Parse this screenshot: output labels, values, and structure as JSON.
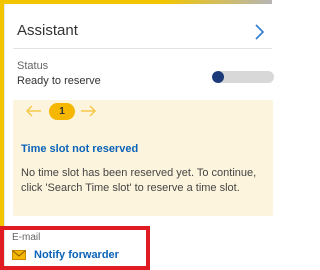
{
  "header": {
    "title": "Assistant"
  },
  "status": {
    "label": "Status",
    "value": "Ready to reserve",
    "toggle_on": false
  },
  "card": {
    "step_number": "1",
    "title": "Time slot not reserved",
    "body": "No time slot has been reserved yet. To continue, click 'Search Time slot' to reserve a time slot."
  },
  "email": {
    "label": "E-mail",
    "action_label": "Notify forwarder",
    "icon": "envelope-icon"
  },
  "colors": {
    "accent": "#f2c500",
    "link": "#0a63b8",
    "card_bg": "#fdf4dd",
    "highlight": "#e11b22"
  }
}
